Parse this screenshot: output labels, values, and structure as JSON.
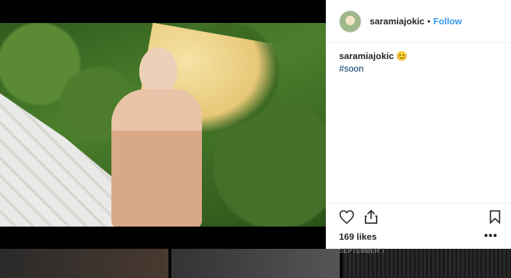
{
  "post": {
    "username": "saramiajokic",
    "dot": "•",
    "follow_label": "Follow",
    "caption_user": "saramiajokic",
    "caption_emoji": "😊",
    "hashtag": "#soon",
    "likes": "169 likes",
    "date": "SEPTEMBER 7",
    "more_label": "•••"
  },
  "icons": {
    "like": "heart-outline-icon",
    "share": "share-icon",
    "save": "bookmark-icon",
    "more": "more-dots-icon"
  },
  "colors": {
    "link_blue": "#3897f0",
    "hashtag": "#003569",
    "text": "#262626",
    "muted": "#999999"
  }
}
